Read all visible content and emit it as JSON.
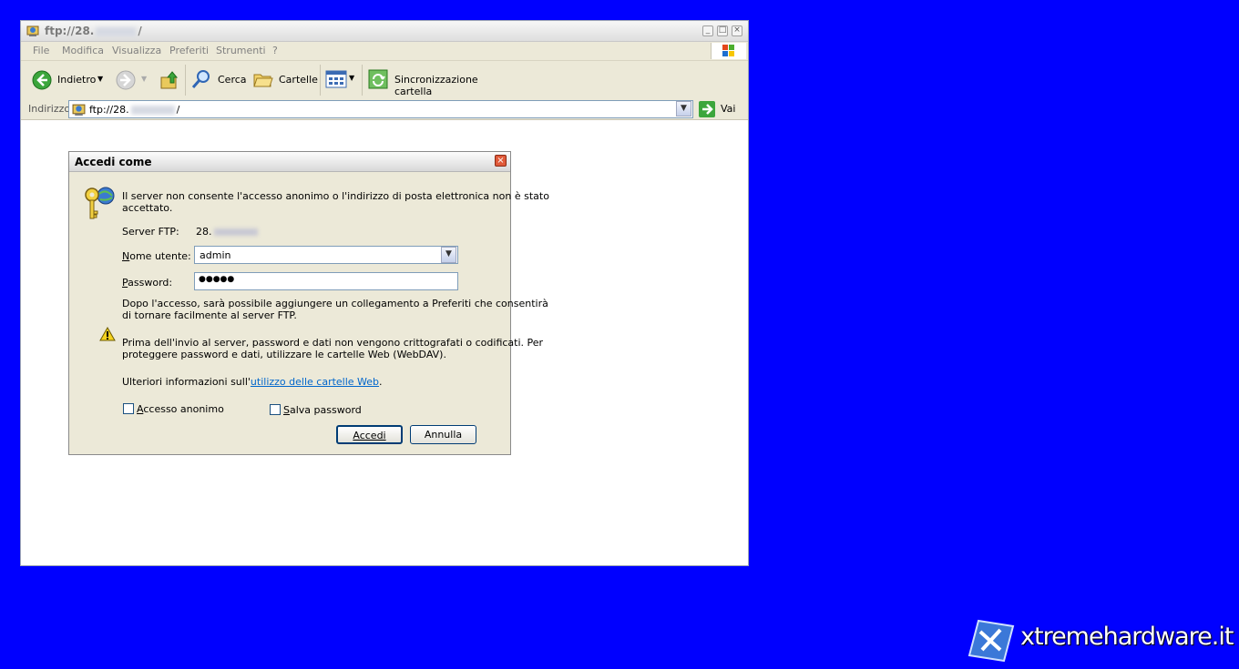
{
  "window": {
    "title_prefix": "ftp://28.",
    "title_suffix": "/",
    "menu": [
      "File",
      "Modifica",
      "Visualizza",
      "Preferiti",
      "Strumenti",
      "?"
    ],
    "toolbar": {
      "back_label": "Indietro",
      "search_label": "Cerca",
      "folders_label": "Cartelle",
      "sync_label": "Sincronizzazione cartella"
    },
    "address": {
      "label": "Indirizzo",
      "value_prefix": "ftp://28.",
      "value_suffix": "/",
      "go_label": "Vai"
    }
  },
  "dialog": {
    "title": "Accedi come",
    "intro_line1": "Il server non consente l'accesso anonimo o l'indirizzo di posta elettronica non è stato",
    "intro_line2": "accettato.",
    "server_label": "Server FTP:",
    "server_value": "28.",
    "username_label": "Nome utente:",
    "username_value": "admin",
    "password_label": "Password:",
    "password_value": "●●●●●",
    "after_line1": "Dopo l'accesso, sarà possibile aggiungere un collegamento a Preferiti che consentirà",
    "after_line2": "di tornare facilmente al server FTP.",
    "warn_line1": "Prima dell'invio al server, password e dati non vengono crittografati o codificati. Per",
    "warn_line2": "proteggere password e dati, utilizzare le cartelle Web (WebDAV).",
    "more_info_prefix": "Ulteriori informazioni sull'",
    "more_info_link": "utilizzo delle cartelle Web",
    "more_info_suffix": ".",
    "anon_label": "Accesso anonimo",
    "save_pw_label": "Salva password",
    "ok_label": "Accedi",
    "cancel_label": "Annulla"
  },
  "watermark": "xtremehardware.it"
}
